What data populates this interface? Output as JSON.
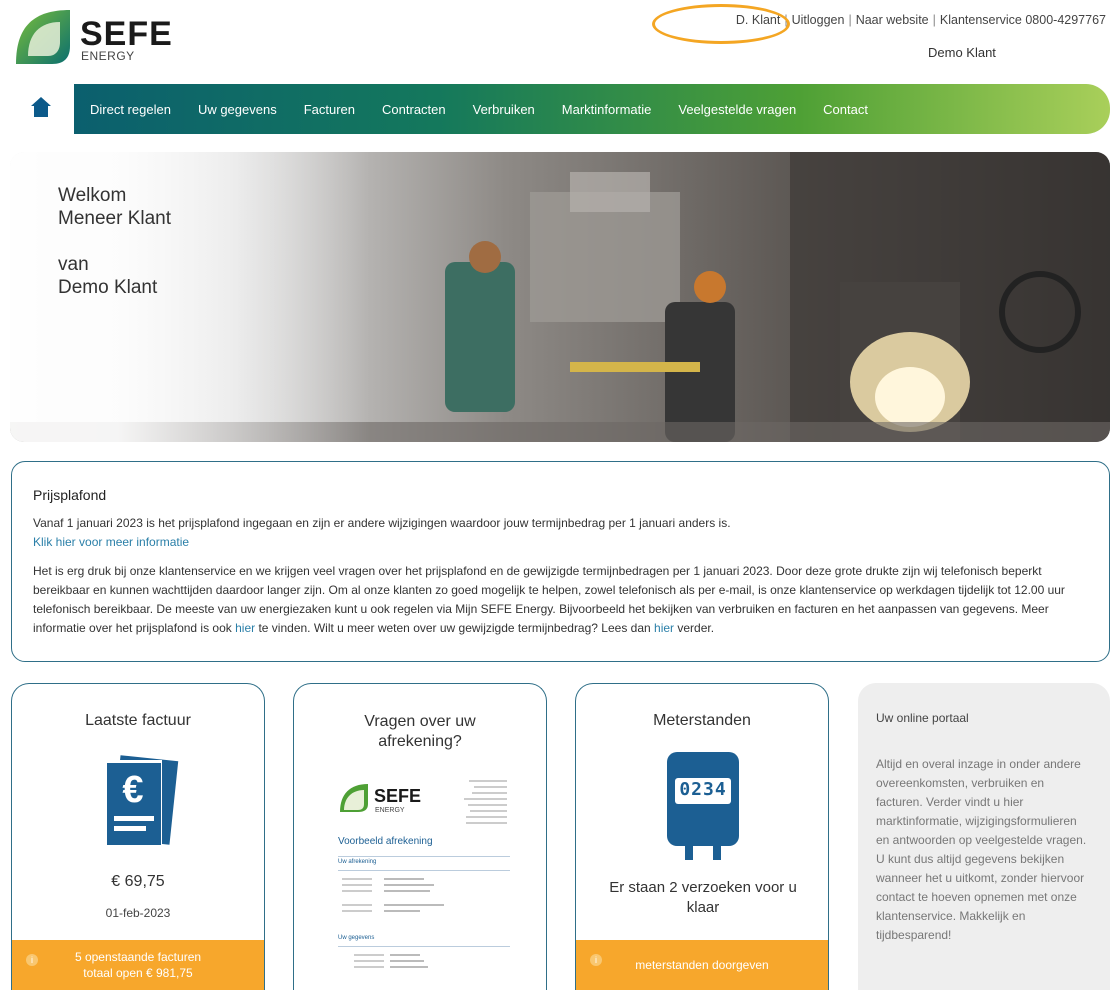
{
  "brand": {
    "name": "SEFE",
    "sub": "ENERGY",
    "colors": {
      "teal": "#0b5f6e",
      "green": "#4ea035",
      "lime": "#a9cf5a",
      "orange": "#f7a72c",
      "border": "#2f6f88"
    }
  },
  "toplinks": {
    "user": "D. Klant",
    "logout": "Uitloggen",
    "website": "Naar website",
    "service": "Klantenservice 0800-4297767"
  },
  "account_name": "Demo Klant",
  "nav": {
    "home_icon": "home-icon",
    "items": [
      "Direct regelen",
      "Uw gegevens",
      "Facturen",
      "Contracten",
      "Verbruiken",
      "Marktinformatie",
      "Veelgestelde vragen",
      "Contact"
    ]
  },
  "hero": {
    "line1": "Welkom",
    "line2": "Meneer Klant",
    "line3": "van",
    "line4": "Demo Klant"
  },
  "notice": {
    "title": "Prijsplafond",
    "p1": "Vanaf 1 januari 2023 is het prijsplafond ingegaan en zijn er andere wijzigingen waardoor jouw termijnbedrag per 1 januari anders is.",
    "link": "Klik hier voor meer informatie",
    "p2a": "Het is erg druk bij onze klantenservice en we krijgen veel vragen over het prijsplafond en de gewijzigde termijnbedragen per 1 januari 2023. Door deze grote drukte zijn wij telefonisch beperkt bereikbaar en kunnen wachttijden daardoor langer zijn. Om al onze klanten zo goed mogelijk te helpen, zowel telefonisch als per e-mail, is onze klantenservice op werkdagen tijdelijk tot 12.00 uur telefonisch bereikbaar. De meeste van uw energiezaken kunt u ook regelen via Mijn SEFE Energy. Bijvoorbeeld het bekijken van verbruiken en facturen en het aanpassen van gegevens. Meer informatie over het prijsplafond is ook ",
    "hier1": "hier",
    "p2b": " te vinden. Wilt u meer weten over uw gewijzigde termijnbedrag? Lees dan ",
    "hier2": "hier",
    "p2c": " verder."
  },
  "cards": {
    "invoice": {
      "title": "Laatste factuur",
      "amount": "€ 69,75",
      "date": "01-feb-2023",
      "footer1": "5 openstaande facturen",
      "footer2": "totaal open € 981,75"
    },
    "questions": {
      "title1": "Vragen over uw",
      "title2": "afrekening?",
      "doc_heading": "Voorbeeld afrekening",
      "doc_section1": "Uw afrekening",
      "doc_section2": "Uw gegevens"
    },
    "meter": {
      "title": "Meterstanden",
      "reading": "0234",
      "message": "Er staan 2 verzoeken voor u klaar",
      "footer": "meterstanden doorgeven"
    },
    "portal": {
      "title": "Uw online portaal",
      "text": "Altijd en overal inzage in onder andere overeenkomsten, verbruiken en facturen. Verder vindt u hier marktinformatie, wijzigingsformulieren en antwoorden op veelgestelde vragen. U kunt dus altijd gegevens bekijken wanneer het u uitkomt, zonder hiervoor contact te hoeven opnemen met onze klantenservice. Makkelijk en tijdbesparend!"
    }
  }
}
